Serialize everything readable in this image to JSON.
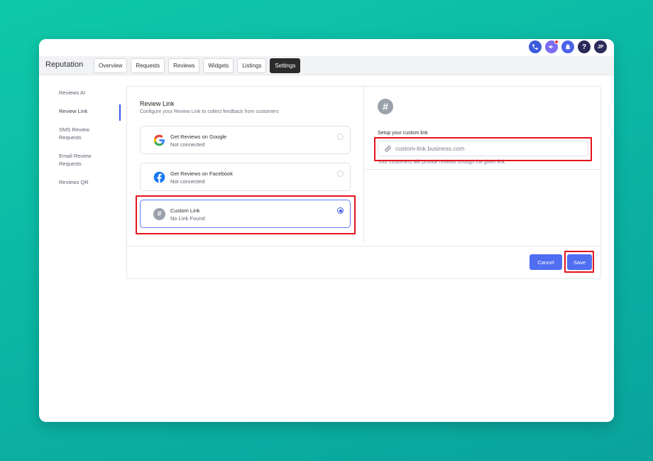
{
  "header": {
    "app_title": "Reputation",
    "icons": [
      {
        "name": "phone-icon",
        "color": "#3b5bdb"
      },
      {
        "name": "megaphone-icon",
        "color": "#7b6cf0"
      },
      {
        "name": "bell-icon",
        "color": "#4c63e6"
      },
      {
        "name": "help-icon",
        "color": "#2a2a5a"
      }
    ],
    "avatar_initials": "JP"
  },
  "tabs": [
    "Overview",
    "Requests",
    "Reviews",
    "Widgets",
    "Listings",
    "Settings"
  ],
  "active_tab": "Settings",
  "sidebar": {
    "items": [
      "Reviews AI",
      "Review Link",
      "SMS Review Requests",
      "Email Review Requests",
      "Reviews QR"
    ],
    "active": "Review Link"
  },
  "review_link": {
    "title": "Review Link",
    "subtitle": "Configure your Review Link to collect feedback from customers",
    "options": [
      {
        "icon": "google-icon",
        "title": "Get Reviews on Google",
        "status": "Not connected",
        "selected": false
      },
      {
        "icon": "facebook-icon",
        "title": "Get Reviews on Facebook",
        "status": "Not connected",
        "selected": false
      },
      {
        "icon": "hash-icon",
        "title": "Custom Link",
        "status": "No Link Found",
        "selected": true
      }
    ]
  },
  "custom_link": {
    "icon": "hash-icon",
    "label": "Setup your custom link",
    "placeholder": "custom-link.business.com",
    "value": "",
    "help": "Your customers will provide reviews through the given link"
  },
  "actions": {
    "cancel_label": "Cancel",
    "save_label": "Save"
  },
  "colors": {
    "accent": "#4f6ef2",
    "highlight": "#e2141b",
    "background": "#0fc9a9"
  }
}
